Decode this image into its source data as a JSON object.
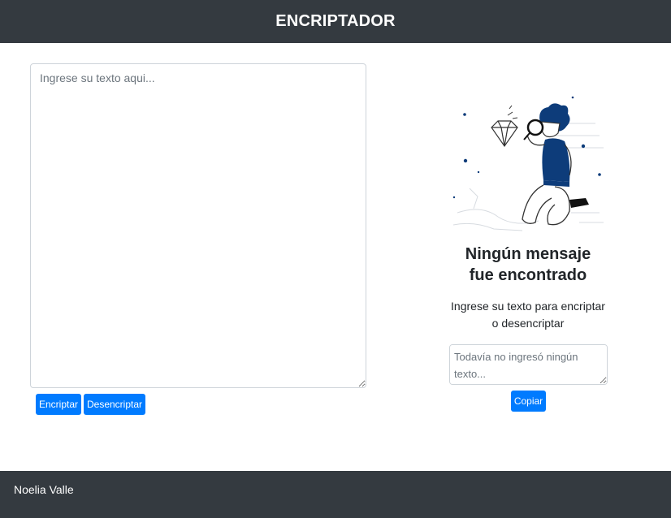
{
  "header": {
    "title": "ENCRIPTADOR"
  },
  "input": {
    "placeholder": "Ingrese su texto aqui...",
    "value": ""
  },
  "buttons": {
    "encrypt_label": "Encriptar",
    "decrypt_label": "Desencriptar",
    "copy_label": "Copiar"
  },
  "result": {
    "title_line1": "Ningún mensaje",
    "title_line2": "fue encontrado",
    "subtitle_line1": "Ingrese su texto para encriptar",
    "subtitle_line2": "o desencriptar",
    "output_placeholder": "Todavía no ingresó ningún texto...",
    "output_value": ""
  },
  "footer": {
    "author": "Noelia Valle"
  },
  "colors": {
    "header_bg": "#343a40",
    "button_primary": "#007bff",
    "illustration_blue": "#0d3c7a"
  },
  "icons": [
    "diamond-icon",
    "magnifying-glass-icon"
  ]
}
